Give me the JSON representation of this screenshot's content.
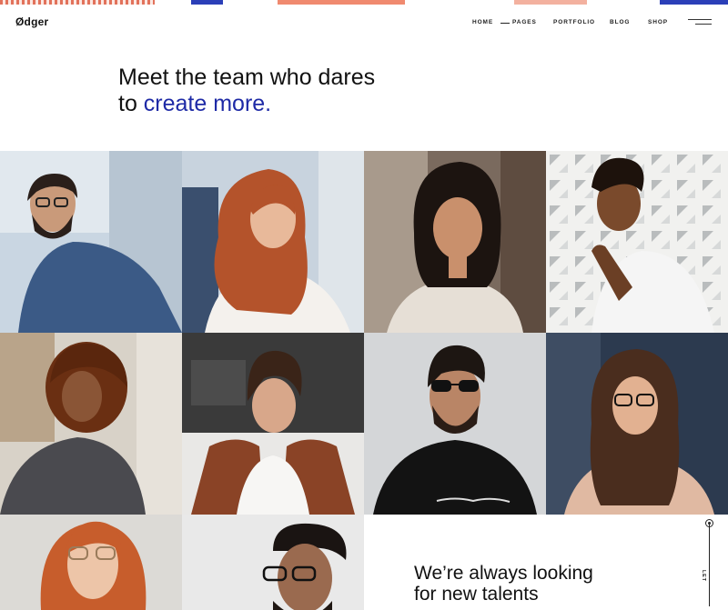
{
  "brand": {
    "logo": "Ødger"
  },
  "nav": {
    "items": [
      "HOME",
      "PAGES",
      "PORTFOLIO",
      "BLOG",
      "SHOP"
    ],
    "menu_icon": "hamburger-icon"
  },
  "hero": {
    "line1": "Meet the team who dares",
    "line2_plain": "to ",
    "line2_accent": "create more.",
    "accent_color": "#1e2aa6"
  },
  "team_photos": [
    "team-member-photo-1",
    "team-member-photo-2",
    "team-member-photo-3",
    "team-member-photo-4",
    "team-member-photo-5",
    "team-member-photo-6",
    "team-member-photo-7",
    "team-member-photo-8",
    "team-member-photo-9",
    "team-member-photo-10"
  ],
  "cta": {
    "line1": "We’re always looking",
    "line2": "for new talents",
    "scroll_label": "LET"
  },
  "colors": {
    "text": "#111111",
    "accent": "#1e2aa6",
    "background": "#ffffff"
  }
}
